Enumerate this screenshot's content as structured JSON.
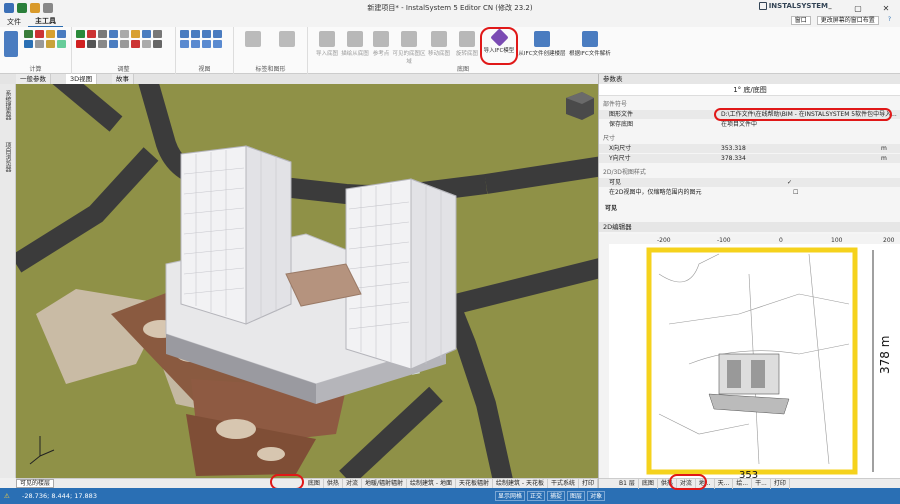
{
  "window": {
    "title": "新建项目* - InstalSystem 5 Editor CN (修改 23.2)",
    "logo": "INSTALSYSTEM",
    "minimize": "–",
    "maximize": "▢",
    "close": "✕"
  },
  "menu": {
    "file": "文件",
    "main_tools": "主工具",
    "window_label": "窗口",
    "layout_label": "更改屏幕的窗口布置"
  },
  "ribbon": {
    "groups": [
      "计算",
      "调整",
      "视图",
      "标签和图形",
      "底图"
    ],
    "big_buttons": [
      "导入底图",
      "描绘从底图",
      "参考点",
      "可见的底图区域",
      "移动底图",
      "旋转底图",
      "导入IFC模型",
      "从IFC文件创建楼层",
      "根据IFC文件解析"
    ]
  },
  "tabs": {
    "general_params": "一般参数",
    "view3d": "3D视图",
    "floor_plan": "故事"
  },
  "left_strip": {
    "label1": "系统搜索器",
    "label2": "项目浏览器"
  },
  "view3d": {
    "gizmo_label": "Z X Y"
  },
  "bottom_bar": {
    "visible_floors": "可见的楼层",
    "tabs": [
      "底图",
      "供热",
      "对流",
      "地暖/辐射辐射",
      "绘制建筑 - 地面",
      "天花板辐射",
      "绘制建筑 - 天花板",
      "干式系统",
      "打印"
    ]
  },
  "status": {
    "coords": "-28.736; 8.444; 17.883",
    "right_buttons": [
      "显示网格",
      "正交",
      "捕捉",
      "图层",
      "对象"
    ]
  },
  "params_panel": {
    "header": "参数表",
    "title": "1° 底/底图",
    "section_underlay": "部件符号",
    "file_label": "图形文件",
    "file_value": "D:\\工作文件\\在线帮助\\BIM - 在INSTALSYSTEM 5软件包中导入...",
    "save_label": "保存底图",
    "save_value": "在项目文件中",
    "section_size": "尺寸",
    "x_label": "X向尺寸",
    "x_value": "353.318",
    "y_label": "Y向尺寸",
    "y_value": "378.334",
    "unit": "m",
    "section_style": "2D/3D视图样式",
    "visible_label": "可见",
    "in2d_label": "在2D视图中，仅缩略范围内的图元",
    "visible_footer": "可见"
  },
  "view2d": {
    "header": "2D编辑器",
    "ruler_ticks": [
      "-200",
      "-100",
      "0",
      "100",
      "200"
    ],
    "dim_vertical": "378 m",
    "dim_bottom": "353"
  },
  "right_bottom": {
    "floor": "B1 层",
    "tabs": [
      "底图",
      "供热",
      "对流",
      "地...",
      "天...",
      "绘...",
      "干...",
      "打印"
    ]
  },
  "colors": {
    "accent": "#2a6fb4",
    "highlight": "#e01818",
    "terrain": "#8f9147",
    "underlay_frame": "#f5d21c"
  }
}
